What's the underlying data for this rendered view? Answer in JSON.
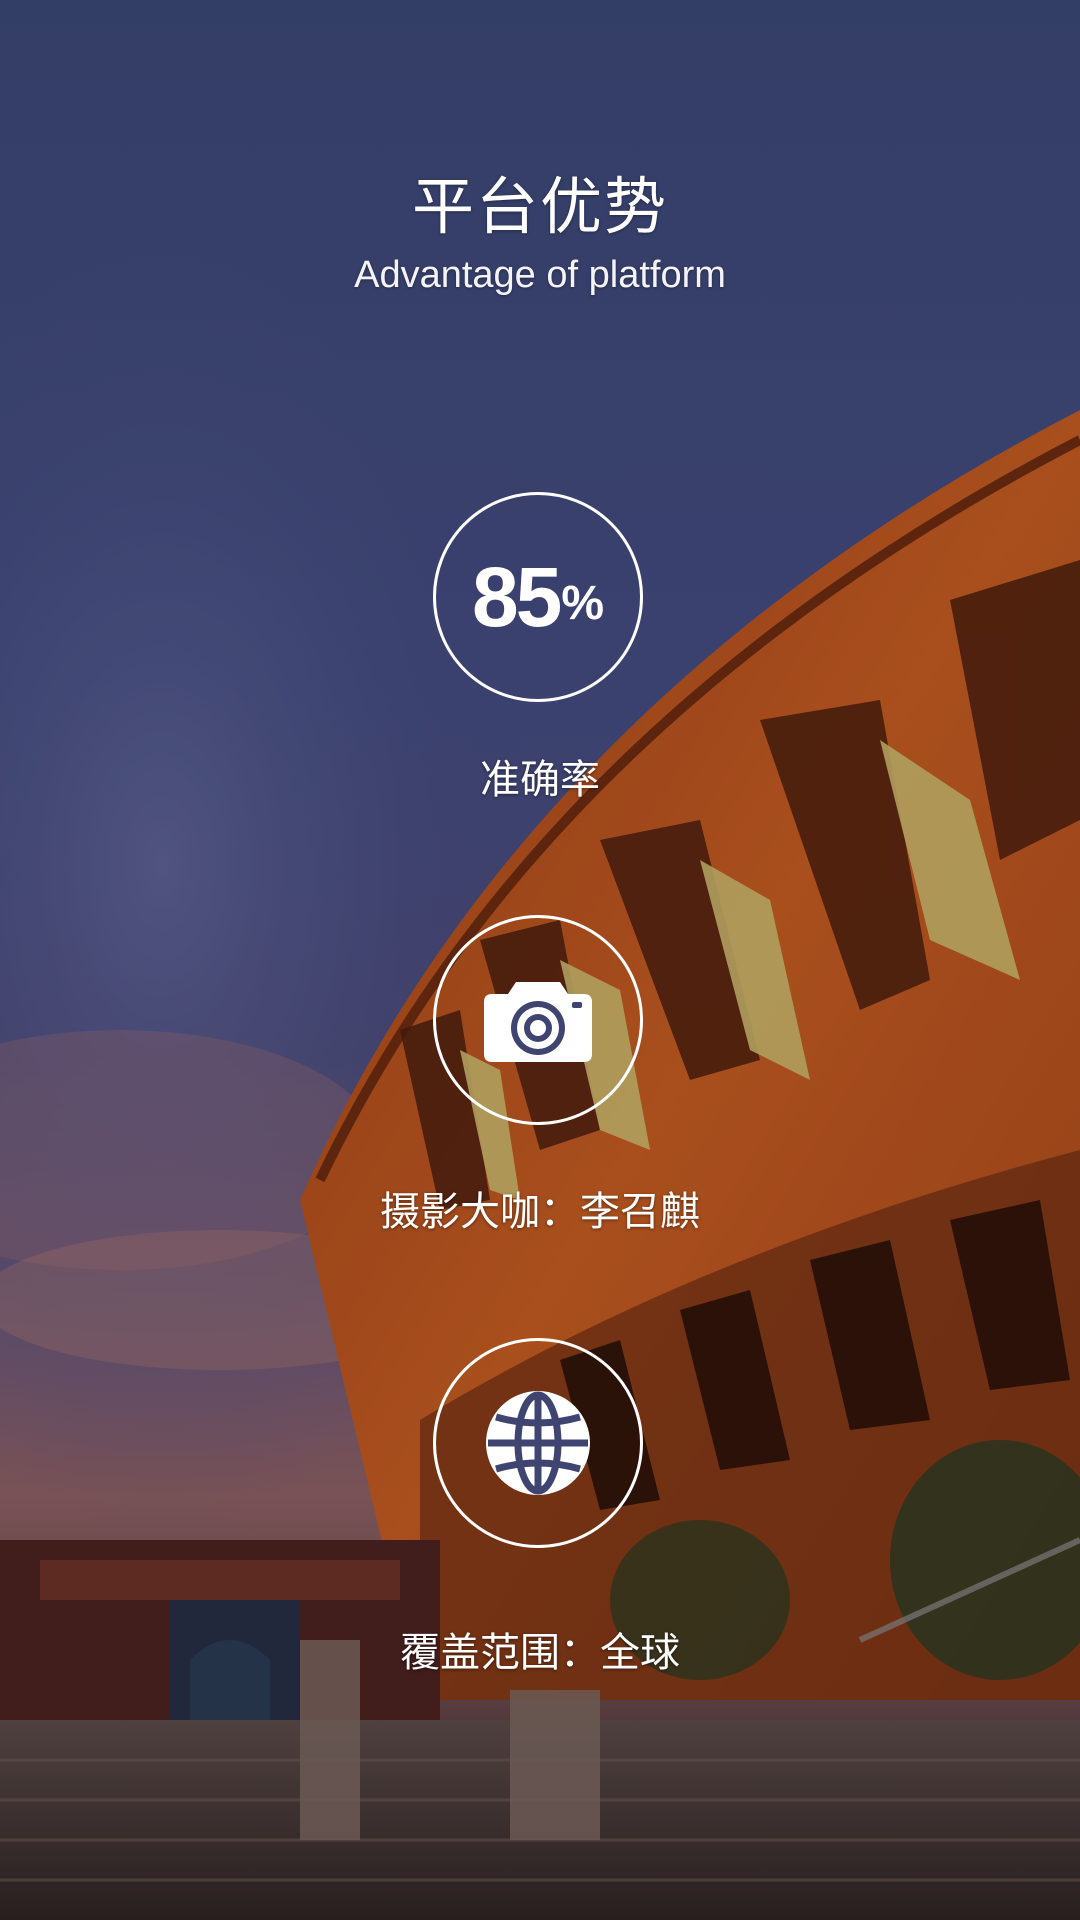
{
  "header": {
    "title": "平台优势",
    "subtitle": "Advantage of platform"
  },
  "features": [
    {
      "icon": "percent-badge",
      "value": "85",
      "unit": "%",
      "label": "准确率"
    },
    {
      "icon": "camera-icon",
      "label": "摄影大咖：李召麒"
    },
    {
      "icon": "globe-icon",
      "label": "覆盖范围：全球"
    }
  ],
  "colors": {
    "sky_top": "#3a4a78",
    "sky_mid": "#4a4a80",
    "sky_sunset": "#8a5a5a",
    "building": "#b5521e",
    "building_dark": "#5a2410",
    "window": "#c8b46a",
    "text": "#ffffff"
  }
}
